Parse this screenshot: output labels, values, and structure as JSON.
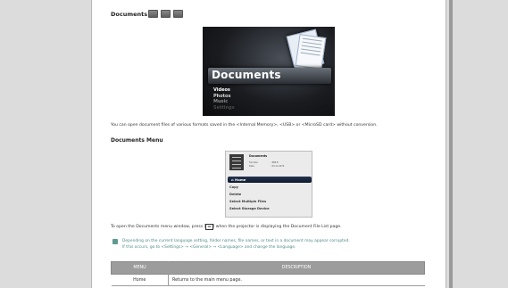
{
  "heading": "Documents",
  "source_icons": [
    "internal-memory-icon",
    "usb-icon",
    "microsd-icon"
  ],
  "hero": {
    "title": "Documents",
    "menu": [
      "Videos",
      "Photos",
      "Music",
      "Settings"
    ]
  },
  "intro_text": "You can open document files of various formats saved in the <Internal Memory>, <USB> or <MicroSD card> without conversion.",
  "menu_heading": "Documents Menu",
  "menu_screen": {
    "file_name": "Documents",
    "file_size_label": "File Size",
    "file_size_value": ": 888 B",
    "date_label": "Date",
    "date_value": ": 00.11.0470",
    "items": [
      "Home",
      "Copy",
      "Delete",
      "Select Multiple Files",
      "Select Storage Device"
    ]
  },
  "instruction_pre": "To open the Documents menu window, press [",
  "instruction_key": "☰",
  "instruction_post": "] when the projector is displaying the Document File List page.",
  "note_line1": "Depending on the current language setting, folder names, file names, or text in a document may appear corrupted.",
  "note_line2": "If this occurs, go to <Settings> → <General> → <Language> and change the language.",
  "table": {
    "headers": [
      "MENU",
      "DESCRIPTION"
    ],
    "rows": [
      {
        "menu": "Home",
        "description": "Returns to the main menu page."
      }
    ]
  }
}
